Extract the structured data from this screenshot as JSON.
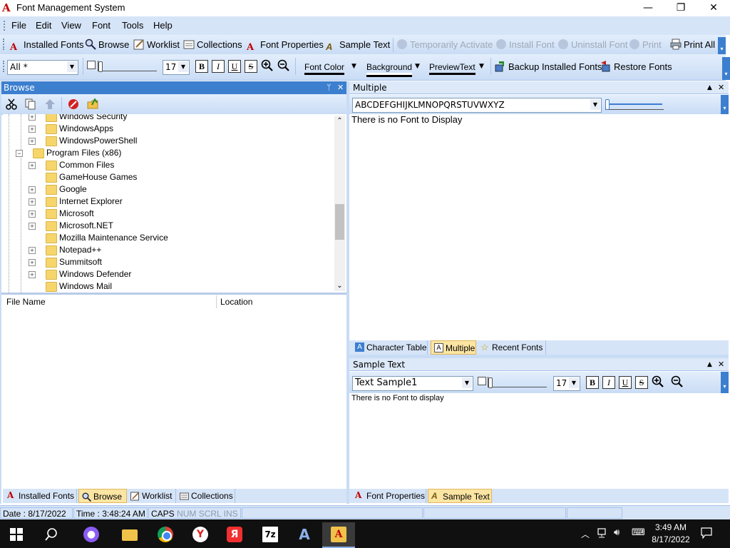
{
  "window": {
    "title": "Font Management System",
    "minimize": "—",
    "maximize": "❐",
    "close": "✕"
  },
  "menu": [
    "File",
    "Edit",
    "View",
    "Font",
    "Tools",
    "Help"
  ],
  "toolbar1": {
    "installed_fonts": "Installed Fonts",
    "browse": "Browse",
    "worklist": "Worklist",
    "collections": "Collections",
    "font_properties": "Font Properties",
    "sample_text": "Sample Text",
    "temporarily_activate": "Temporarily Activate",
    "install_font": "Install Font",
    "uninstall_font": "Uninstall Font",
    "print": "Print",
    "print_all": "Print All"
  },
  "toolbar2": {
    "filter_value": "All *",
    "size_value": "17",
    "bold": "B",
    "italic": "I",
    "underline": "U",
    "strike": "S",
    "font_color": "Font Color",
    "background": "Background",
    "preview_text": "PreviewText",
    "backup": "Backup Installed Fonts",
    "restore": "Restore Fonts"
  },
  "browse_panel": {
    "title": "Browse",
    "tree": [
      {
        "label": "Windows Security",
        "level": 2,
        "expand": "+"
      },
      {
        "label": "WindowsApps",
        "level": 2,
        "expand": "+"
      },
      {
        "label": "WindowsPowerShell",
        "level": 2,
        "expand": "+"
      },
      {
        "label": "Program Files (x86)",
        "level": 1,
        "expand": "−"
      },
      {
        "label": "Common Files",
        "level": 2,
        "expand": "+"
      },
      {
        "label": "GameHouse Games",
        "level": 2,
        "expand": ""
      },
      {
        "label": "Google",
        "level": 2,
        "expand": "+"
      },
      {
        "label": "Internet Explorer",
        "level": 2,
        "expand": "+"
      },
      {
        "label": "Microsoft",
        "level": 2,
        "expand": "+"
      },
      {
        "label": "Microsoft.NET",
        "level": 2,
        "expand": "+"
      },
      {
        "label": "Mozilla Maintenance Service",
        "level": 2,
        "expand": ""
      },
      {
        "label": "Notepad++",
        "level": 2,
        "expand": "+"
      },
      {
        "label": "Summitsoft",
        "level": 2,
        "expand": "+"
      },
      {
        "label": "Windows Defender",
        "level": 2,
        "expand": "+"
      },
      {
        "label": "Windows Mail",
        "level": 2,
        "expand": ""
      }
    ],
    "columns": [
      "File Name",
      "Location"
    ],
    "tabs": [
      "Installed Fonts",
      "Browse",
      "Worklist",
      "Collections"
    ]
  },
  "multiple_panel": {
    "title": "Multiple",
    "sample_string": "ABCDEFGHIJKLMNOPQRSTUVWXYZ",
    "message": "There is no Font to Display",
    "tabs": [
      "Character Table",
      "Multiple",
      "Recent Fonts"
    ]
  },
  "sample_panel": {
    "title": "Sample Text",
    "sample_select": "Text Sample1",
    "size_value": "17",
    "message": "There is no Font to display",
    "tabs": [
      "Font Properties",
      "Sample Text"
    ]
  },
  "statusbar": {
    "date": "Date : 8/17/2022",
    "time": "Time : 3:48:24 AM",
    "caps": "CAPS",
    "num": "NUM",
    "scrl": "SCRL",
    "ins": "INS"
  },
  "taskbar": {
    "time": "3:49 AM",
    "date": "8/17/2022"
  },
  "colors": {
    "header_active": "#3c7fcf",
    "toolbar": "#d6e4f7",
    "active_tab": "#fbe5a3"
  }
}
